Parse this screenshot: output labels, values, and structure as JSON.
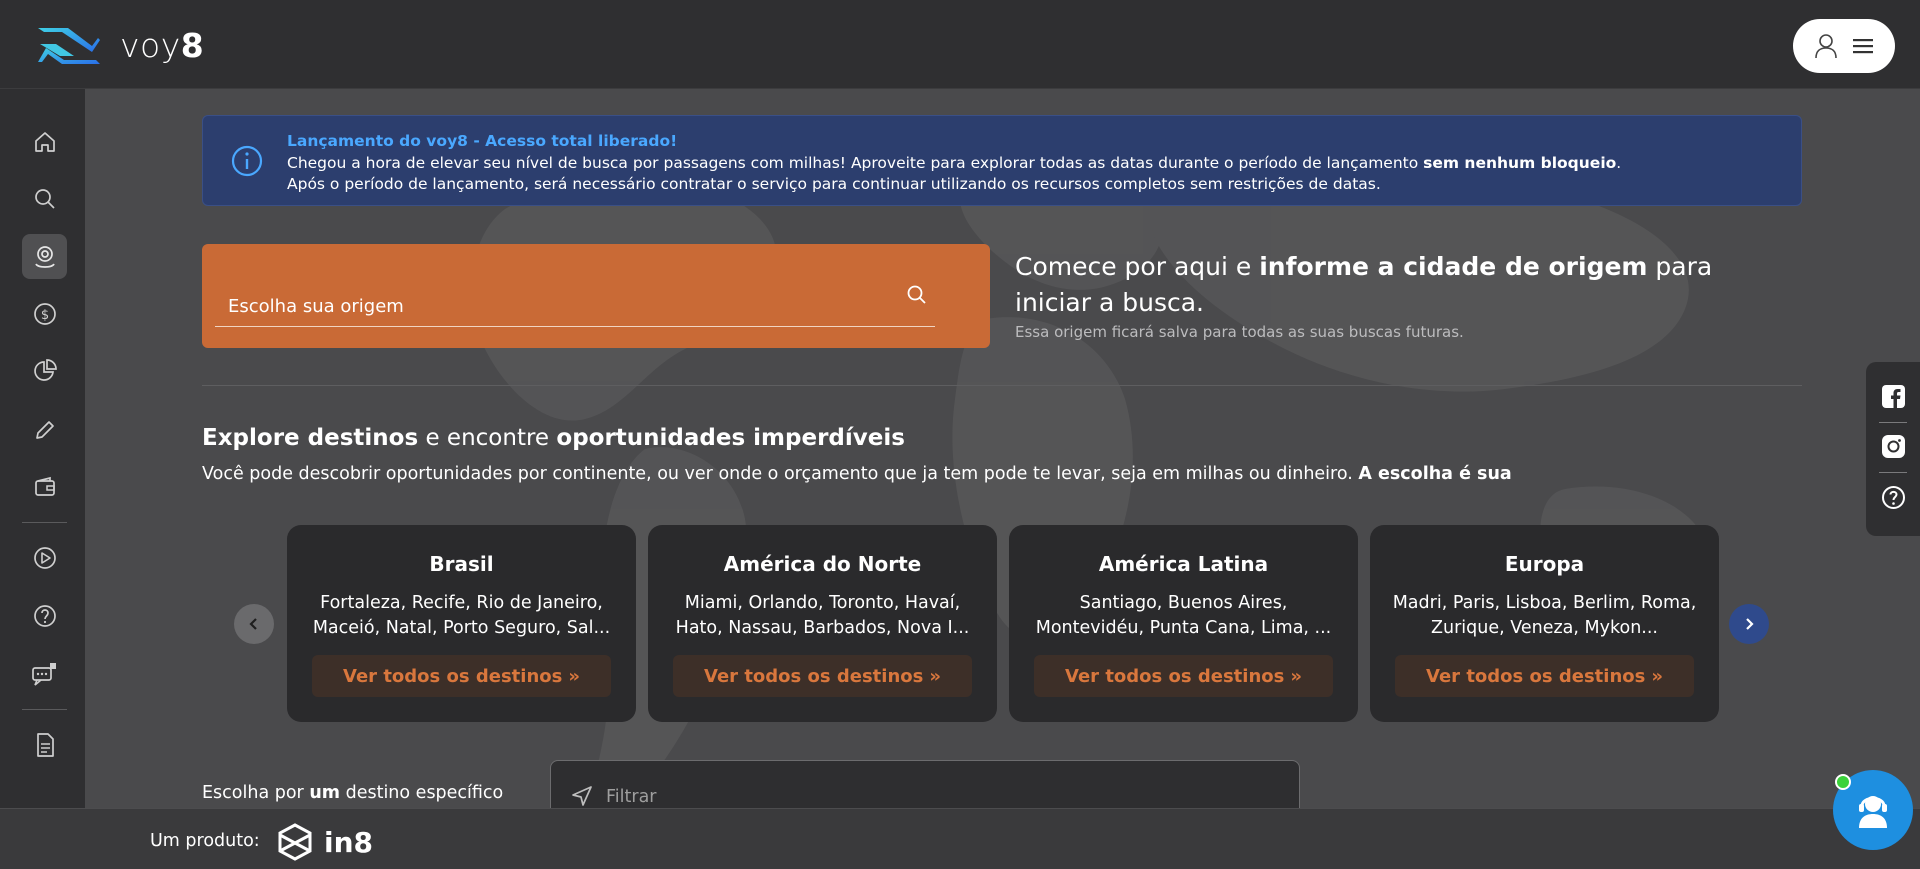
{
  "app": {
    "brand_prefix": "voy",
    "brand_suffix": "8"
  },
  "banner": {
    "title": "Lançamento do voy8 - Acesso total liberado!",
    "text_part1": "Chegou a hora de elevar seu nível de busca por passagens com milhas! Aproveite para explorar todas as datas durante o período de lançamento ",
    "text_bold": "sem nenhum bloqueio",
    "text_part2": ". Após o período de lançamento, será necessário contratar o serviço para continuar utilizando os recursos completos sem restrições de datas."
  },
  "origin": {
    "placeholder": "Escolha sua origem",
    "headline_part1": "Comece por aqui e ",
    "headline_bold": "informe a cidade de origem",
    "headline_part2": " para iniciar a busca.",
    "subtext": "Essa origem ficará salva para todas as suas buscas futuras."
  },
  "explore": {
    "title_bold1": "Explore destinos",
    "title_mid": " e encontre ",
    "title_bold2": "oportunidades imperdíveis",
    "sub_text": "Você pode descobrir oportunidades por continente, ou ver onde o orçamento que ja tem pode te levar, seja em milhas ou dinheiro. ",
    "sub_bold": "A escolha é sua"
  },
  "cards": [
    {
      "title": "Brasil",
      "desc": "Fortaleza, Recife, Rio de Janeiro, Maceió, Natal, Porto Seguro, Sal...",
      "button": "Ver todos os destinos"
    },
    {
      "title": "América do Norte",
      "desc": "Miami, Orlando, Toronto, Havaí, Hato, Nassau, Barbados, Nova I...",
      "button": "Ver todos os destinos"
    },
    {
      "title": "América Latina",
      "desc": "Santiago, Buenos Aires, Montevidéu, Punta Cana, Lima, ...",
      "button": "Ver todos os destinos"
    },
    {
      "title": "Europa",
      "desc": "Madri, Paris, Lisboa, Berlim, Roma, Zurique, Veneza, Mykon...",
      "button": "Ver todos os destinos"
    }
  ],
  "specific": {
    "label_part1": "Escolha por ",
    "label_bold": "um",
    "label_part2": " destino específico",
    "filter_placeholder": "Filtrar"
  },
  "footer": {
    "label": "Um produto:",
    "brand": "in8"
  },
  "colors": {
    "accent_orange": "#c96a36",
    "banner_blue": "#2c3e6e",
    "link_blue": "#4aa8ff",
    "chat_blue": "#1e8fe0",
    "online_green": "#3bd23b"
  },
  "icons": {
    "sidebar": [
      "home-icon",
      "search-icon",
      "location-icon",
      "dollar-icon",
      "pie-chart-icon",
      "pencil-icon",
      "wallet-icon",
      "play-icon",
      "help-icon",
      "chat-bubbles-icon",
      "document-icon"
    ],
    "social": [
      "facebook-icon",
      "instagram-icon",
      "help-icon"
    ]
  }
}
